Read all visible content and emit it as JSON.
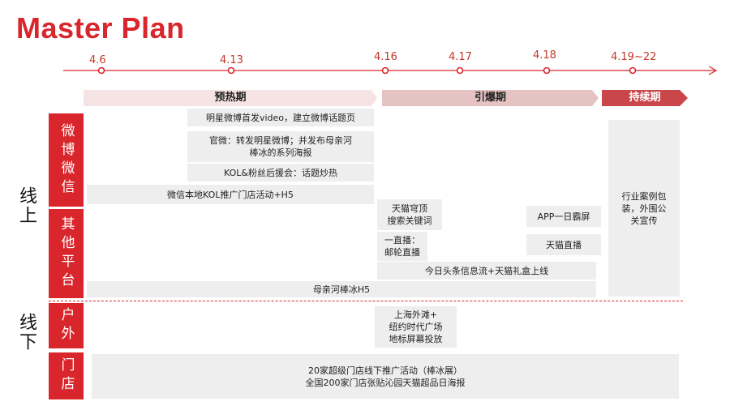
{
  "title": "Master Plan",
  "timeline": {
    "dates": [
      "4.6",
      "4.13",
      "4.16",
      "4.17",
      "4.18",
      "4.19~22"
    ]
  },
  "phases": [
    "预热期",
    "引爆期",
    "持续期"
  ],
  "groups": {
    "online": "线上",
    "offline": "线下"
  },
  "channels": [
    "微博",
    "微信",
    "其他平台",
    "户外",
    "门店"
  ],
  "activities": {
    "a1": "明星微博首发video，建立微博话题页",
    "a2": "官微：转发明星微博；并发布母亲河\n棒冰的系列海报",
    "a3": "KOL&粉丝后援会：话题炒热",
    "a4": "微信本地KOL推广门店活动+H5",
    "a5": "天猫穹顶\n搜索关键词",
    "a6": "APP一日霸屏",
    "a7": "一直播：\n邮轮直播",
    "a8": "天猫直播",
    "a9": "今日头条信息流+天猫礼盒上线",
    "a10": "母亲河棒冰H5",
    "a11": "行业案例包\n装，外围公\n关宣传",
    "a12": "上海外滩+\n纽约时代广场\n地标屏幕投放",
    "a13": "20家超级门店线下推广活动（棒冰展）\n全国200家门店张贴沁园天猫超品日海报"
  },
  "colors": {
    "accent": "#d9262c",
    "phase_light": "#f6e4e4",
    "phase_mid": "#e6c3c3",
    "phase_dark": "#c9474a",
    "box": "#eeeeee"
  }
}
